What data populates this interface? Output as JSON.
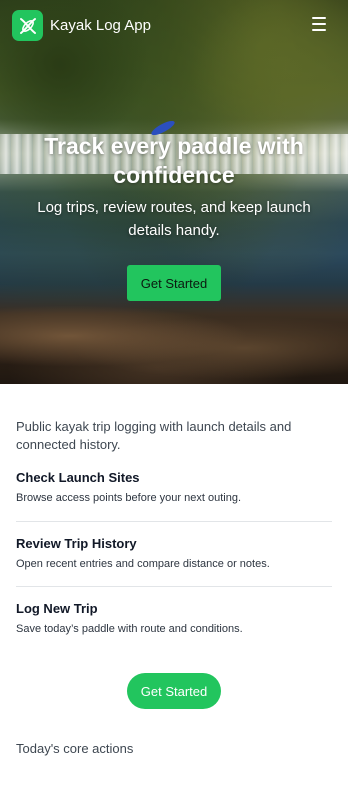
{
  "header": {
    "app_title": "Kayak Log App",
    "logo_icon": "kayak-logo-icon",
    "menu_icon": "hamburger-menu-icon"
  },
  "hero": {
    "title": "Track every paddle with confidence",
    "subtitle": "Log trips, review routes, and keep launch details handy.",
    "cta_label": "Get Started"
  },
  "content": {
    "intro": "Public kayak trip logging with launch details and connected history.",
    "features": [
      {
        "title": "Check Launch Sites",
        "description": "Browse access points before your next outing."
      },
      {
        "title": "Review Trip History",
        "description": "Open recent entries and compare distance or notes."
      },
      {
        "title": "Log New Trip",
        "description": "Save today’s paddle with route and conditions."
      }
    ],
    "cta_label": "Get Started",
    "core_actions_label": "Today's core actions"
  },
  "colors": {
    "accent": "#22c55e",
    "text_dark": "#111827",
    "text_muted": "#3e4751",
    "divider": "#e2e5e8"
  }
}
